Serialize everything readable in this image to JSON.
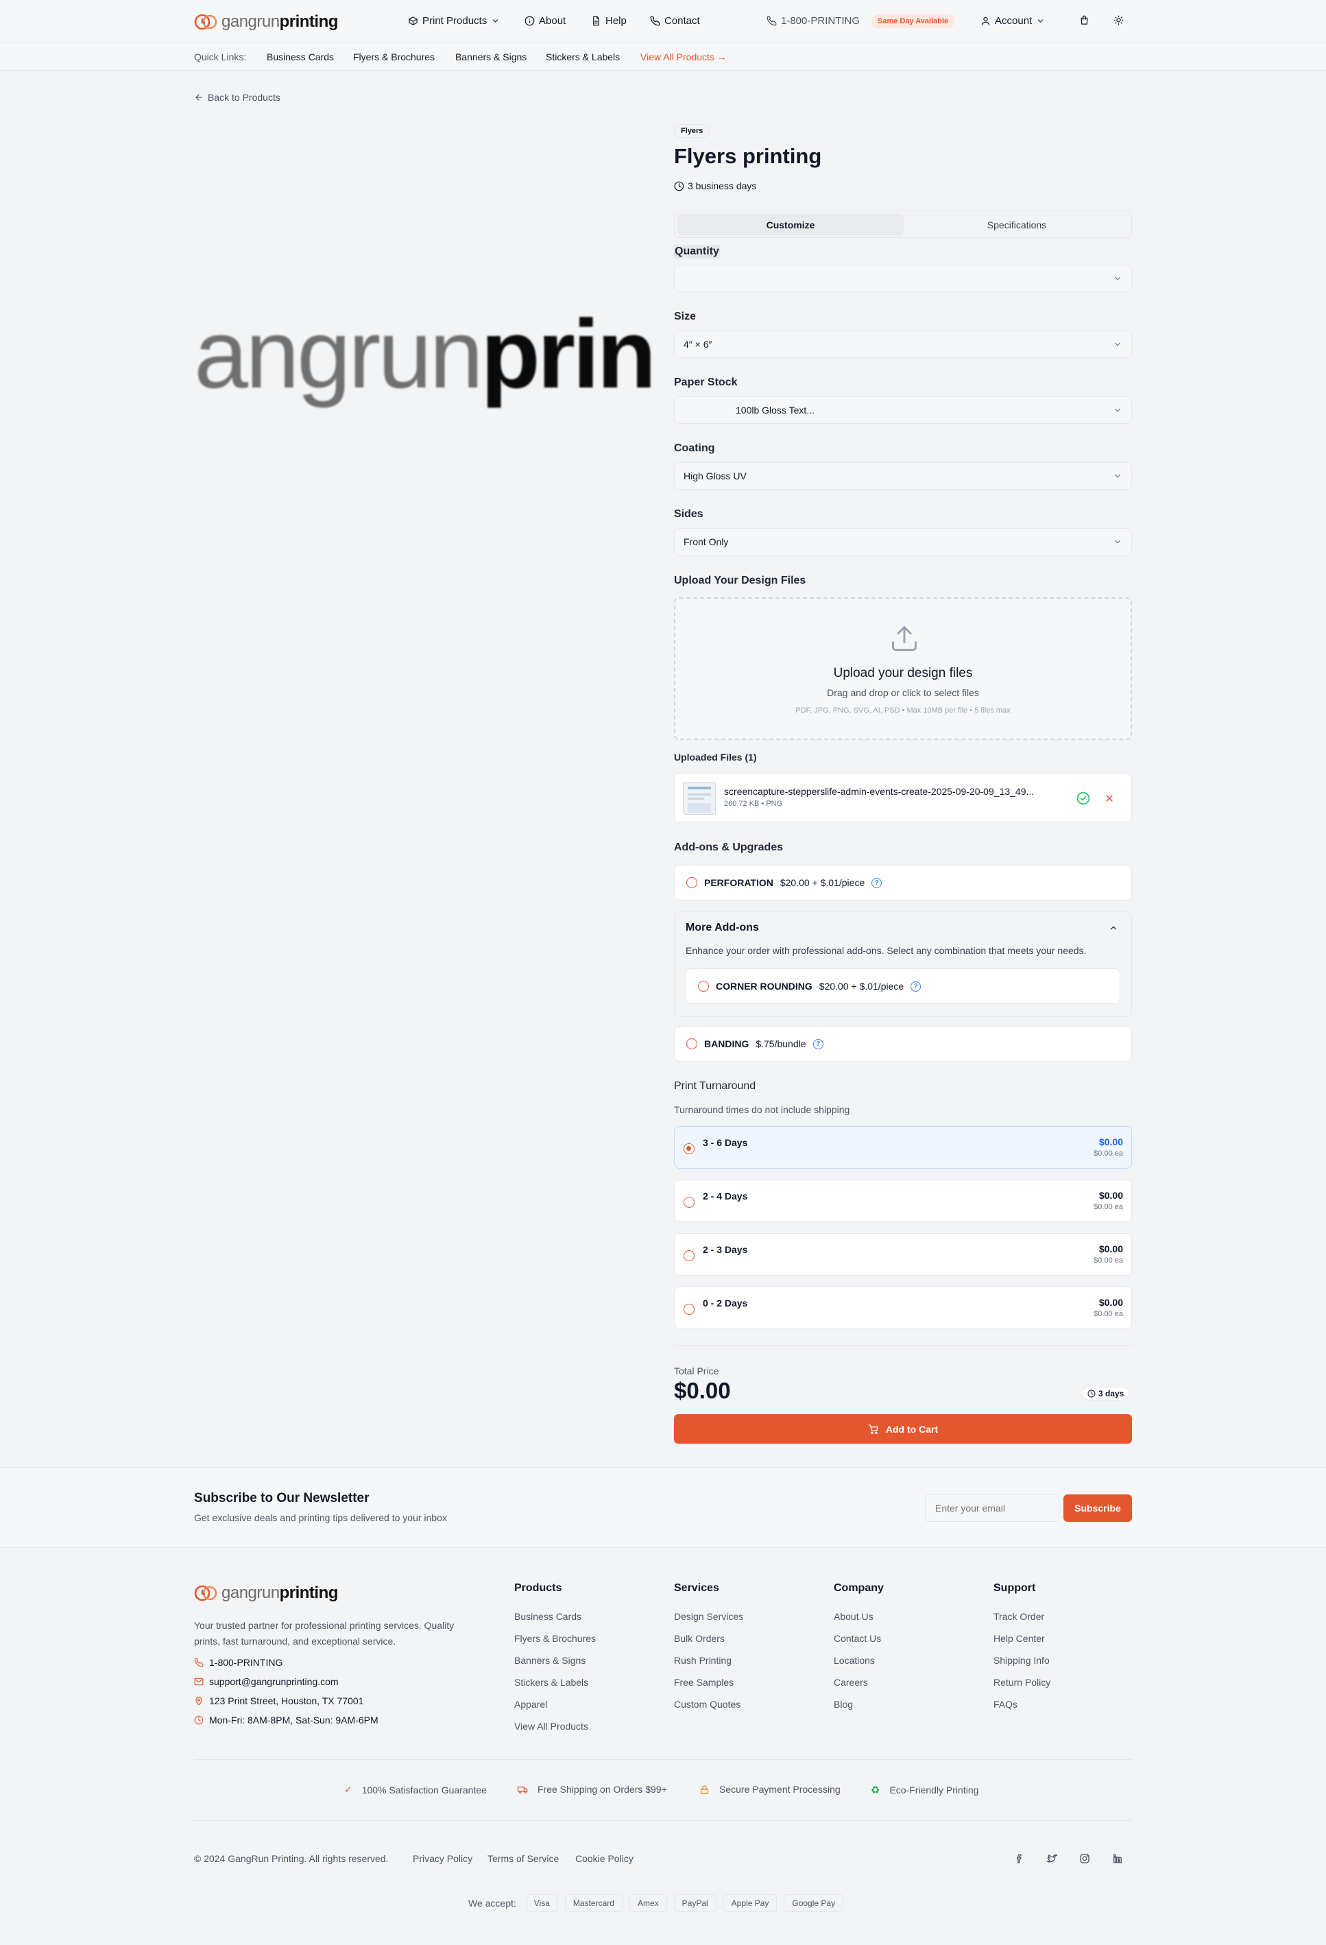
{
  "colors": {
    "brand": "#e4572e",
    "link_accent": "#e4572e",
    "selected_price": "#2563eb",
    "success": "#22c55e"
  },
  "header": {
    "logo_light": "gangrun",
    "logo_bold": "printing",
    "nav": {
      "print_products": "Print Products",
      "about": "About",
      "help": "Help",
      "contact": "Contact"
    },
    "phone": "1-800-PRINTING",
    "same_day_badge": "Same Day Available",
    "account": "Account"
  },
  "quick_links": {
    "label": "Quick Links:",
    "items": [
      "Business Cards",
      "Flyers & Brochures",
      "Banners & Signs",
      "Stickers & Labels"
    ],
    "view_all": "View All Products →"
  },
  "back_link": "Back to Products",
  "product": {
    "image_text_light": "angrun",
    "image_text_bold": "prin",
    "category_badge": "Flyers",
    "title": "Flyers printing",
    "lead_time": "3 business days",
    "tabs": [
      "Customize",
      "Specifications"
    ],
    "active_tab": "Customize"
  },
  "options": {
    "quantity": {
      "label": "Quantity",
      "value": ""
    },
    "size": {
      "label": "Size",
      "value": "4″ × 6″"
    },
    "paper_stock": {
      "label": "Paper Stock",
      "value": "100lb Gloss Text..."
    },
    "coating": {
      "label": "Coating",
      "value": "High Gloss UV"
    },
    "sides": {
      "label": "Sides",
      "value": "Front Only"
    }
  },
  "upload": {
    "section_title": "Upload Your Design Files",
    "title": "Upload your design files",
    "subtitle": "Drag and drop or click to select files",
    "hint": "PDF, JPG, PNG, SVG, AI, PSD • Max 10MB per file • 5 files max",
    "uploaded_title": "Uploaded Files (1)",
    "files": [
      {
        "name": "screencapture-stepperslife-admin-events-create-2025-09-20-09_13_49...",
        "meta": "260.72 KB • PNG"
      }
    ]
  },
  "addons": {
    "section_title": "Add-ons & Upgrades",
    "perforation": {
      "name": "PERFORATION",
      "price": "$20.00 + $.01/piece"
    },
    "more": {
      "title": "More Add-ons",
      "description": "Enhance your order with professional add-ons. Select any combination that meets your needs.",
      "corner": {
        "name": "CORNER ROUNDING",
        "price": "$20.00 + $.01/piece"
      }
    },
    "banding": {
      "name": "BANDING",
      "price": "$.75/bundle"
    }
  },
  "turnaround": {
    "title": "Print Turnaround",
    "note": "Turnaround times do not include shipping",
    "options": [
      {
        "label": "3 - 6 Days",
        "price": "$0.00",
        "each": "$0.00 ea",
        "selected": true
      },
      {
        "label": "2 - 4 Days",
        "price": "$0.00",
        "each": "$0.00 ea",
        "selected": false
      },
      {
        "label": "2 - 3 Days",
        "price": "$0.00",
        "each": "$0.00 ea",
        "selected": false
      },
      {
        "label": "0 - 2 Days",
        "price": "$0.00",
        "each": "$0.00 ea",
        "selected": false
      }
    ]
  },
  "total": {
    "label": "Total Price",
    "amount": "$0.00",
    "days": "3 days",
    "add_to_cart": "Add to Cart"
  },
  "newsletter": {
    "title": "Subscribe to Our Newsletter",
    "subtitle": "Get exclusive deals and printing tips delivered to your inbox",
    "placeholder": "Enter your email",
    "button": "Subscribe"
  },
  "footer": {
    "about": "Your trusted partner for professional printing services. Quality prints, fast turnaround, and exceptional service.",
    "contact": {
      "phone": "1-800-PRINTING",
      "email": "support@gangrunprinting.com",
      "address": "123 Print Street, Houston, TX 77001",
      "hours": "Mon-Fri: 8AM-8PM, Sat-Sun: 9AM-6PM"
    },
    "columns": [
      {
        "title": "Products",
        "links": [
          "Business Cards",
          "Flyers & Brochures",
          "Banners & Signs",
          "Stickers & Labels",
          "Apparel",
          "View All Products"
        ]
      },
      {
        "title": "Services",
        "links": [
          "Design Services",
          "Bulk Orders",
          "Rush Printing",
          "Free Samples",
          "Custom Quotes"
        ]
      },
      {
        "title": "Company",
        "links": [
          "About Us",
          "Contact Us",
          "Locations",
          "Careers",
          "Blog"
        ]
      },
      {
        "title": "Support",
        "links": [
          "Track Order",
          "Help Center",
          "Shipping Info",
          "Return Policy",
          "FAQs"
        ]
      }
    ],
    "badges": [
      {
        "icon": "check-icon",
        "text": "100% Satisfaction Guarantee"
      },
      {
        "icon": "truck-icon",
        "text": "Free Shipping on Orders $99+"
      },
      {
        "icon": "lock-icon",
        "text": "Secure Payment Processing"
      },
      {
        "icon": "recycle-icon",
        "text": "Eco-Friendly Printing"
      }
    ],
    "copyright": "© 2024 GangRun Printing. All rights reserved.",
    "legal": [
      "Privacy Policy",
      "Terms of Service",
      "Cookie Policy"
    ],
    "we_accept": "We accept:",
    "payments": [
      "Visa",
      "Mastercard",
      "Amex",
      "PayPal",
      "Apple Pay",
      "Google Pay"
    ]
  }
}
